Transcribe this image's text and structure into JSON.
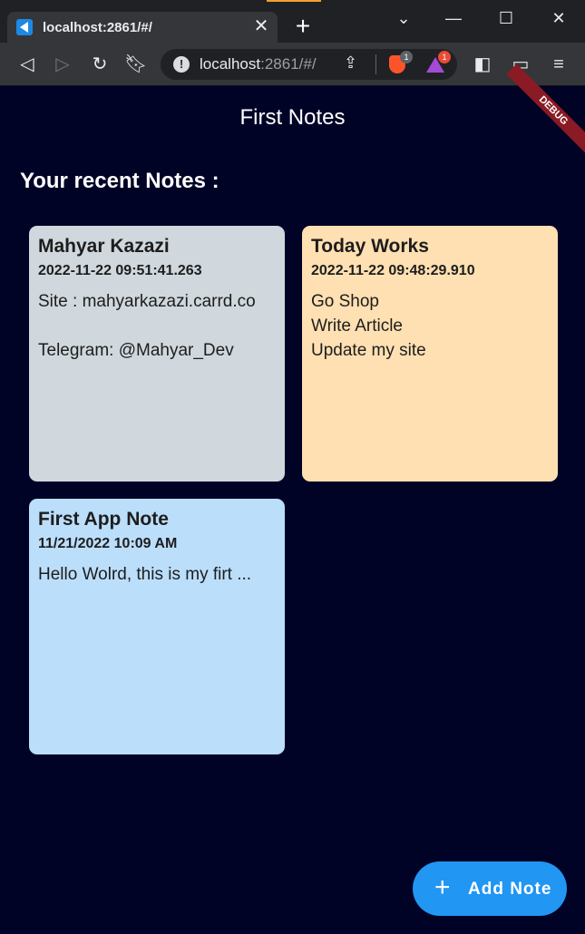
{
  "browser": {
    "tab_title": "localhost:2861/#/",
    "tab_close": "✕",
    "new_tab": "+",
    "url_host": "localhost",
    "url_rest": ":2861/#/",
    "brave_badge": "1",
    "rewards_badge": "1",
    "icons": {
      "back": "back-icon",
      "forward": "forward-icon",
      "reload": "reload-icon",
      "bookmark": "bookmark-icon",
      "info": "info-icon",
      "share": "share-icon",
      "sidebar": "sidebar-icon",
      "wallet": "wallet-icon",
      "menu": "menu-icon"
    }
  },
  "app": {
    "title": "First Notes",
    "debug_label": "DEBUG",
    "section_title": "Your recent Notes :",
    "notes": [
      {
        "title": "Mahyar Kazazi",
        "date": "2022-11-22 09:51:41.263",
        "content": "Site : mahyarkazazi.carrd.co\n\nTelegram: @Mahyar_Dev",
        "color": "#d0d8dd"
      },
      {
        "title": "Today Works",
        "date": "2022-11-22 09:48:29.910",
        "content": "Go Shop\nWrite Article\nUpdate my site",
        "color": "#ffe0b2"
      },
      {
        "title": "First App Note",
        "date": "11/21/2022 10:09 AM",
        "content": "Hello Wolrd, this is my firt ...",
        "color": "#bbdefb"
      }
    ],
    "fab_icon": "+",
    "fab_label": "Add Note"
  },
  "colors": {
    "background": "#000326",
    "fab": "#2196f3",
    "debug_banner": "#8a1a23"
  }
}
